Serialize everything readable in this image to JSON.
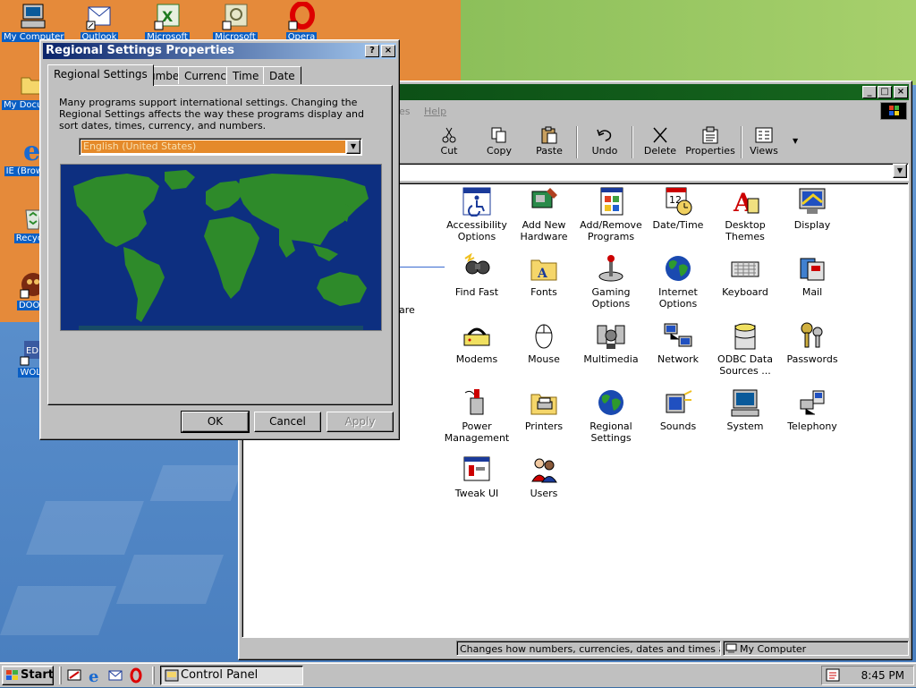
{
  "desktop": {
    "icons": [
      {
        "label": "My Computer"
      },
      {
        "label": "Outlook"
      },
      {
        "label": "Microsoft"
      },
      {
        "label": "Microsoft"
      },
      {
        "label": "Opera"
      },
      {
        "label": "My Documents"
      },
      {
        "label": "IE (Browser)"
      },
      {
        "label": "Recycle"
      },
      {
        "label": "DOOM"
      },
      {
        "label": "WOLF"
      }
    ]
  },
  "control_panel": {
    "menu": {
      "help_label": "Help",
      "faded_label": "es"
    },
    "toolbar": {
      "cut": "Cut",
      "copy": "Copy",
      "paste": "Paste",
      "undo": "Undo",
      "delete": "Delete",
      "properties": "Properties",
      "views": "Views"
    },
    "side_text": "are",
    "items": [
      {
        "label": "Accessibility Options",
        "icon": "accessibility-icon"
      },
      {
        "label": "Add New Hardware",
        "icon": "hardware-icon"
      },
      {
        "label": "Add/Remove Programs",
        "icon": "programs-icon"
      },
      {
        "label": "Date/Time",
        "icon": "calendar-clock-icon"
      },
      {
        "label": "Desktop Themes",
        "icon": "themes-icon"
      },
      {
        "label": "Display",
        "icon": "display-icon"
      },
      {
        "label": "Find Fast",
        "icon": "find-fast-icon"
      },
      {
        "label": "Fonts",
        "icon": "fonts-folder-icon"
      },
      {
        "label": "Gaming Options",
        "icon": "joystick-icon"
      },
      {
        "label": "Internet Options",
        "icon": "globe-icon"
      },
      {
        "label": "Keyboard",
        "icon": "keyboard-icon"
      },
      {
        "label": "Mail",
        "icon": "mail-icon"
      },
      {
        "label": "Modems",
        "icon": "modem-icon"
      },
      {
        "label": "Mouse",
        "icon": "mouse-icon"
      },
      {
        "label": "Multimedia",
        "icon": "multimedia-icon"
      },
      {
        "label": "Network",
        "icon": "network-icon"
      },
      {
        "label": "ODBC Data Sources ...",
        "icon": "odbc-icon"
      },
      {
        "label": "Passwords",
        "icon": "keys-icon"
      },
      {
        "label": "Power Management",
        "icon": "power-icon"
      },
      {
        "label": "Printers",
        "icon": "printers-folder-icon"
      },
      {
        "label": "Regional Settings",
        "icon": "globe-icon"
      },
      {
        "label": "Sounds",
        "icon": "speaker-icon"
      },
      {
        "label": "System",
        "icon": "computer-icon"
      },
      {
        "label": "Telephony",
        "icon": "telephone-icon"
      },
      {
        "label": "Tweak UI",
        "icon": "tweakui-icon"
      },
      {
        "label": "Users",
        "icon": "users-icon"
      }
    ],
    "status": {
      "description": "Changes how numbers, currencies, dates and times are disp",
      "zone": "My Computer"
    }
  },
  "dialog": {
    "title": "Regional Settings Properties",
    "help_button": "?",
    "close_button": "×",
    "tabs": [
      "Regional Settings",
      "Number",
      "Currency",
      "Time",
      "Date"
    ],
    "description": "Many programs support international settings. Changing the Regional Settings affects the way these programs display and sort dates, times, currency, and numbers.",
    "locale_selected": "English (United States)",
    "buttons": {
      "ok": "OK",
      "cancel": "Cancel",
      "apply": "Apply"
    }
  },
  "taskbar": {
    "start_label": "Start",
    "task_label": "Control Panel",
    "clock": "8:45 PM"
  }
}
